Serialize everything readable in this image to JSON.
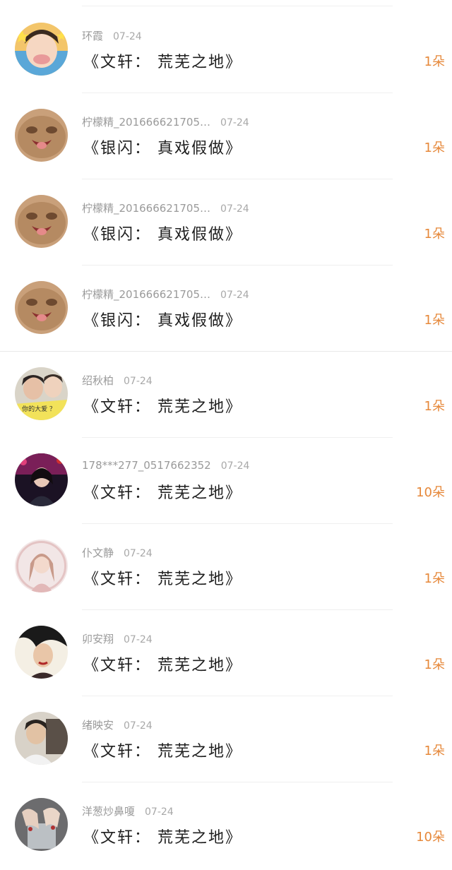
{
  "entries": [
    {
      "user": "环霞",
      "date": "07-24",
      "gift": "《文轩： 荒芜之地》",
      "count": "1朵",
      "avatar": "cartoon-boy"
    },
    {
      "user": "柠檬精_201666621705…",
      "date": "07-24",
      "gift": "《银闪： 真戏假做》",
      "count": "1朵",
      "avatar": "cat"
    },
    {
      "user": "柠檬精_201666621705…",
      "date": "07-24",
      "gift": "《银闪： 真戏假做》",
      "count": "1朵",
      "avatar": "cat"
    },
    {
      "user": "柠檬精_201666621705…",
      "date": "07-24",
      "gift": "《银闪： 真戏假做》",
      "count": "1朵",
      "avatar": "cat"
    },
    {
      "user": "绍秋柏",
      "date": "07-24",
      "gift": "《文轩： 荒芜之地》",
      "count": "1朵",
      "avatar": "couple",
      "avatar_caption": "你的大爱 ？"
    },
    {
      "user": "178***277_0517662352",
      "date": "07-24",
      "gift": "《文轩： 荒芜之地》",
      "count": "10朵",
      "avatar": "stage-singer"
    },
    {
      "user": "仆文静",
      "date": "07-24",
      "gift": "《文轩： 荒芜之地》",
      "count": "1朵",
      "avatar": "girl-portrait"
    },
    {
      "user": "卯安翔",
      "date": "07-24",
      "gift": "《文轩： 荒芜之地》",
      "count": "1朵",
      "avatar": "woman-portrait"
    },
    {
      "user": "绪映安",
      "date": "07-24",
      "gift": "《文轩： 荒芜之地》",
      "count": "1朵",
      "avatar": "man-photo"
    },
    {
      "user": "洋葱炒鼻嗄",
      "date": "07-24",
      "gift": "《文轩： 荒芜之地》",
      "count": "10朵",
      "avatar": "hands-glass"
    }
  ],
  "colors": {
    "count": "#e6883a",
    "username": "#9a9a9a",
    "title": "#1f1f1f",
    "divider": "#efefef"
  }
}
